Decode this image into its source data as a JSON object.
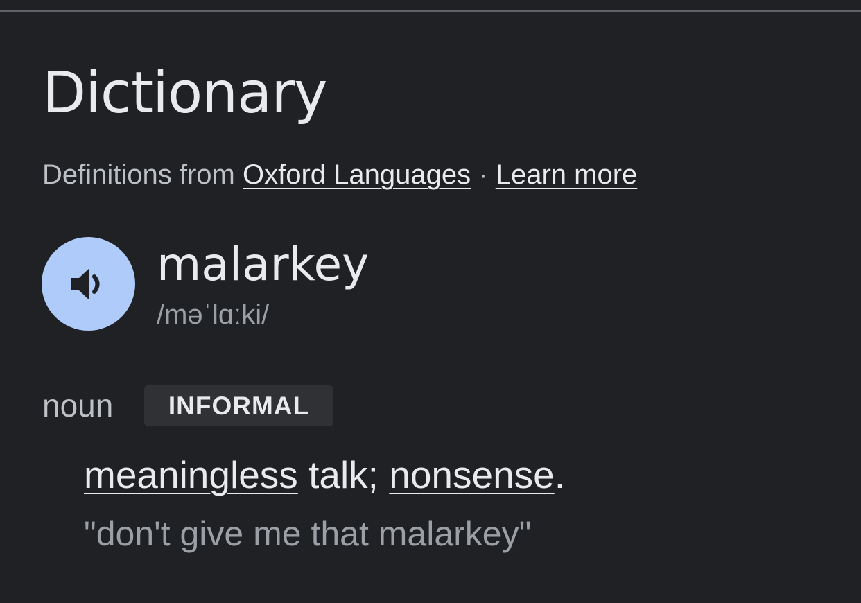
{
  "card": {
    "title": "Dictionary",
    "source_prefix": "Definitions from",
    "source_link": "Oxford Languages",
    "separator": "·",
    "learn_more": "Learn more"
  },
  "entry": {
    "word": "malarkey",
    "phonetic": "/məˈlɑːki/",
    "audio_icon": "speaker-icon",
    "part_of_speech": "noun",
    "register": "INFORMAL",
    "definition": {
      "link1": "meaningless",
      "mid": " talk; ",
      "link2": "nonsense",
      "end": "."
    },
    "example": "\"don't give me that malarkey\""
  },
  "colors": {
    "background": "#202124",
    "audio_button": "#aecbfa",
    "badge": "#303134"
  }
}
